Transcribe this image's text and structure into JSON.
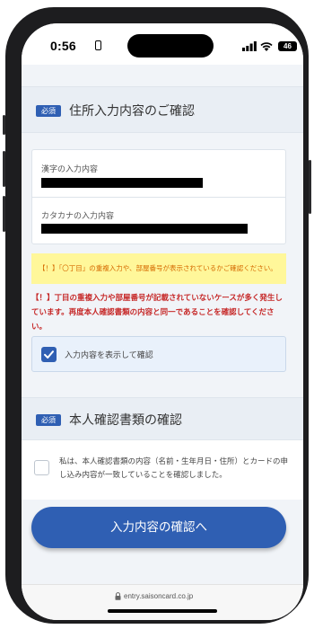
{
  "status_bar": {
    "time": "0:56",
    "battery_level": "46"
  },
  "address_section": {
    "badge": "必須",
    "title": "住所入力内容のご確認",
    "kanji_label": "漢字の入力内容",
    "katakana_label": "カタカナの入力内容",
    "yellow_notice": "【！】「〇丁目」の重複入力や、部屋番号が表示されているかご確認ください。",
    "warning": "【！】丁目の重複入力や部屋番号が記載されていないケースが多く発生しています。再度本人確認書類の内容と同一であることを確認してください。",
    "show_checkbox_label": "入力内容を表示して確認"
  },
  "id_section": {
    "badge": "必須",
    "title": "本人確認書類の確認",
    "consent_text": "私は、本人確認書類の内容（名前・生年月日・住所）とカードの申し込み内容が一致していることを確認しました。"
  },
  "submit_label": "入力内容の確認へ",
  "url": "entry.saisoncard.co.jp",
  "colors": {
    "accent": "#2f5fb3",
    "warning_red": "#c62828",
    "notice_yellow": "#fff79a",
    "notice_orange": "#d66a00"
  },
  "icons": [
    "id-card-icon",
    "cellular-signal-icon",
    "wifi-icon",
    "battery-icon",
    "checkmark-icon",
    "lock-icon"
  ]
}
